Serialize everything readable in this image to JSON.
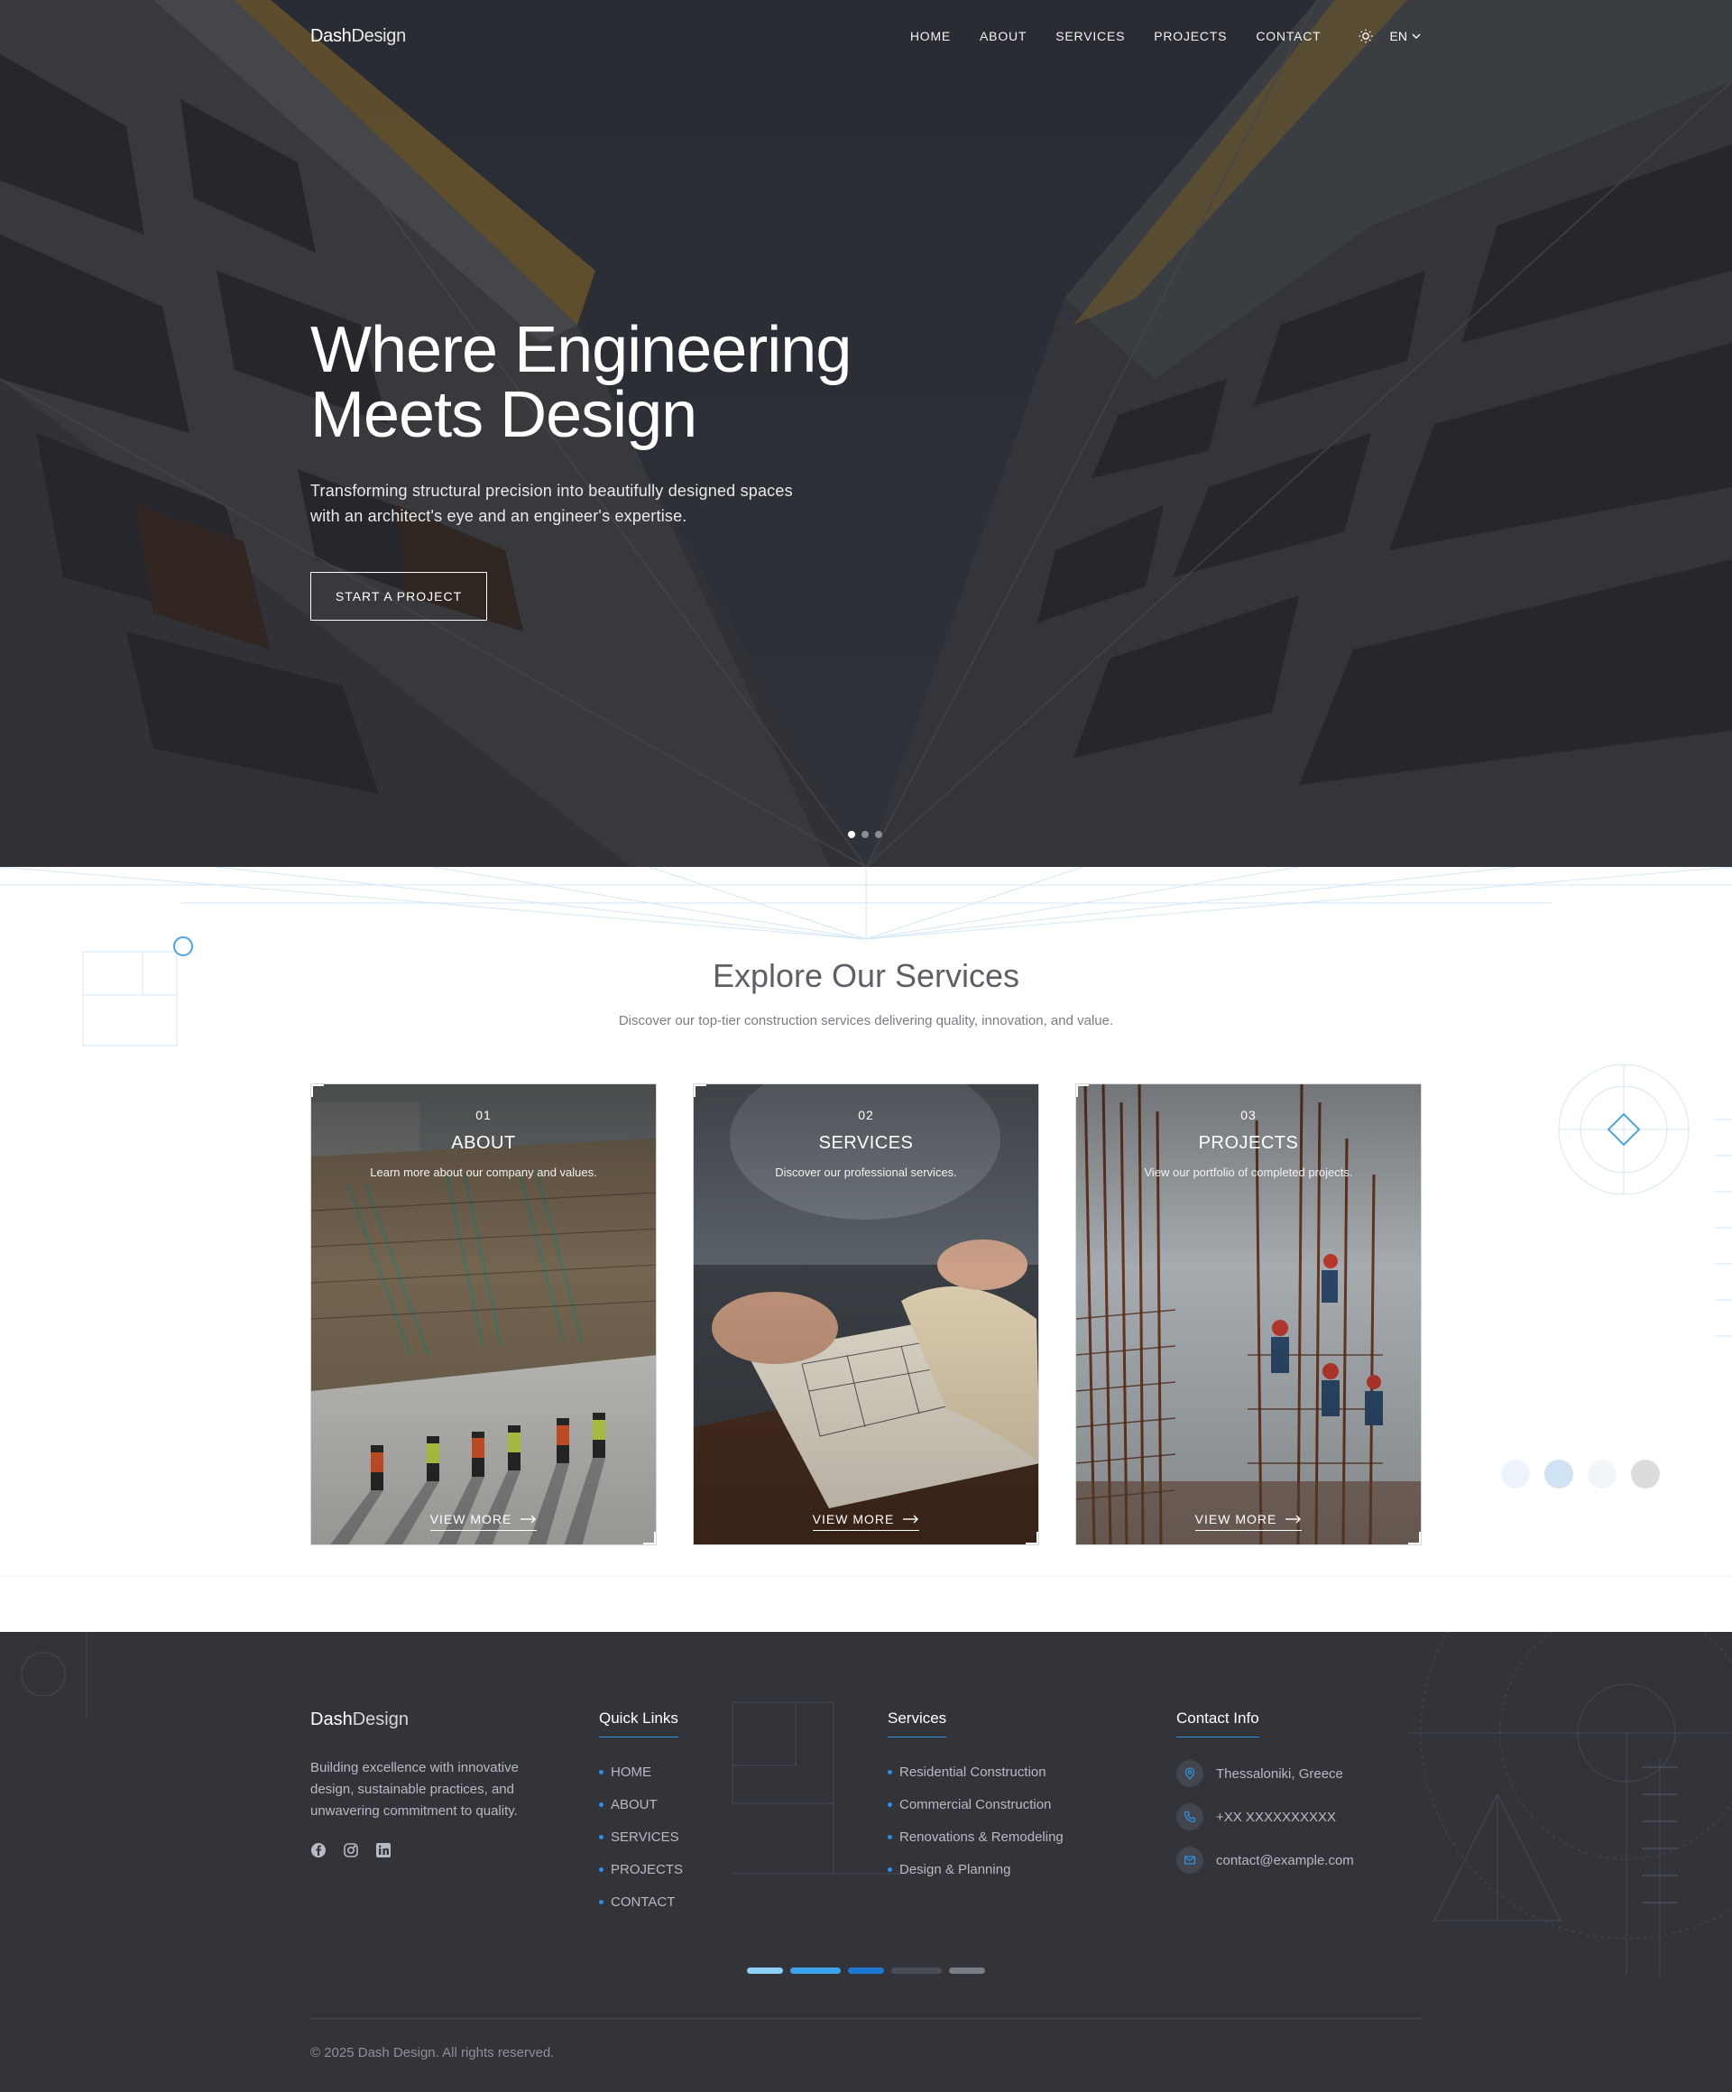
{
  "brand": {
    "name_bold": "Dash",
    "name_light": "Design"
  },
  "nav": {
    "links": [
      "HOME",
      "ABOUT",
      "SERVICES",
      "PROJECTS",
      "CONTACT"
    ],
    "theme_icon": "sun-icon",
    "language": "EN"
  },
  "hero": {
    "title_line1": "Where Engineering",
    "title_line2": "Meets Design",
    "subtitle_line1": "Transforming structural precision into beautifully designed spaces",
    "subtitle_line2": "with an architect's eye and an engineer's expertise.",
    "cta_label": "START A PROJECT",
    "slide_count": 3,
    "active_slide": 1
  },
  "services": {
    "title": "Explore Our Services",
    "subtitle": "Discover our top-tier construction services delivering quality, innovation, and value.",
    "cards": [
      {
        "number": "01",
        "title": "ABOUT",
        "description": "Learn more about our company and values.",
        "more_label": "VIEW MORE"
      },
      {
        "number": "02",
        "title": "SERVICES",
        "description": "Discover our professional services.",
        "more_label": "VIEW MORE"
      },
      {
        "number": "03",
        "title": "PROJECTS",
        "description": "View our portfolio of completed projects.",
        "more_label": "VIEW MORE"
      }
    ]
  },
  "footer": {
    "about": "Building excellence with innovative design, sustainable practices, and unwavering commitment to quality.",
    "social_icons": [
      "facebook-icon",
      "instagram-icon",
      "linkedin-icon"
    ],
    "quick_links": {
      "heading": "Quick Links",
      "items": [
        "HOME",
        "ABOUT",
        "SERVICES",
        "PROJECTS",
        "CONTACT"
      ]
    },
    "services": {
      "heading": "Services",
      "items": [
        "Residential Construction",
        "Commercial Construction",
        "Renovations & Remodeling",
        "Design & Planning"
      ]
    },
    "contact": {
      "heading": "Contact Info",
      "location": "Thessaloniki, Greece",
      "phone": "+XX XXXXXXXXXX",
      "email": "contact@example.com"
    },
    "copyright": "© 2025 Dash Design. All rights reserved."
  },
  "colors": {
    "accent": "#2f8fe0",
    "footer_bg": "#32343a",
    "hero_overlay": "#2f3237"
  }
}
